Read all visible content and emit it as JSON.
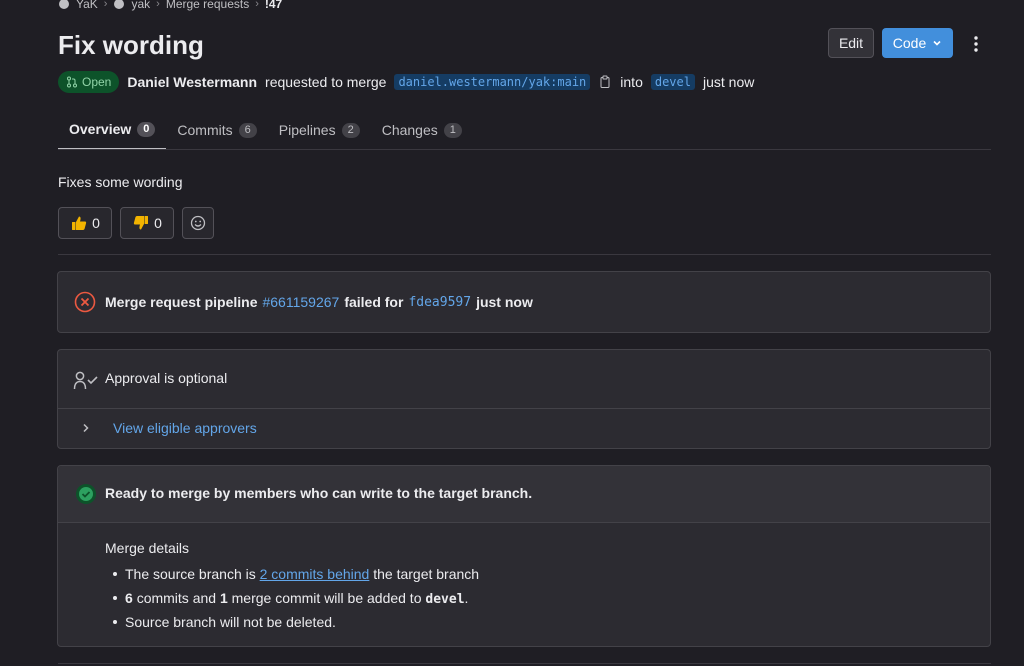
{
  "breadcrumb": {
    "items": [
      "YaK",
      "yak",
      "Merge requests",
      "!47"
    ]
  },
  "title": "Fix wording",
  "actions": {
    "edit_label": "Edit",
    "code_label": "Code"
  },
  "meta": {
    "status": "Open",
    "author": "Daniel Westermann",
    "requested_text": "requested to merge",
    "source_branch": "daniel.westermann/yak:main",
    "into_text": "into",
    "target_branch": "devel",
    "time": "just now"
  },
  "tabs": [
    {
      "label": "Overview",
      "count": "0"
    },
    {
      "label": "Commits",
      "count": "6"
    },
    {
      "label": "Pipelines",
      "count": "2"
    },
    {
      "label": "Changes",
      "count": "1"
    }
  ],
  "description": "Fixes some wording",
  "reactions": {
    "thumbs_up_count": "0",
    "thumbs_down_count": "0"
  },
  "pipeline": {
    "prefix": "Merge request pipeline",
    "id": "#661159267",
    "failed_text": "failed for",
    "commit": "fdea9597",
    "time": "just now"
  },
  "approval": {
    "text": "Approval is optional",
    "link": "View eligible approvers"
  },
  "merge": {
    "ready_text": "Ready to merge by members who can write to the target branch.",
    "details_title": "Merge details",
    "line1_prefix": "The source branch is",
    "line1_link": "2 commits behind",
    "line1_suffix": "the target branch",
    "line2_count1": "6",
    "line2_mid": "commits and",
    "line2_count2": "1",
    "line2_suffix": "merge commit will be added to",
    "line2_branch": "devel",
    "line3": "Source branch will not be deleted."
  },
  "colors": {
    "background": "#1f1e24",
    "accent": "#428fdc",
    "danger": "#ec5941",
    "success": "#2da160"
  }
}
